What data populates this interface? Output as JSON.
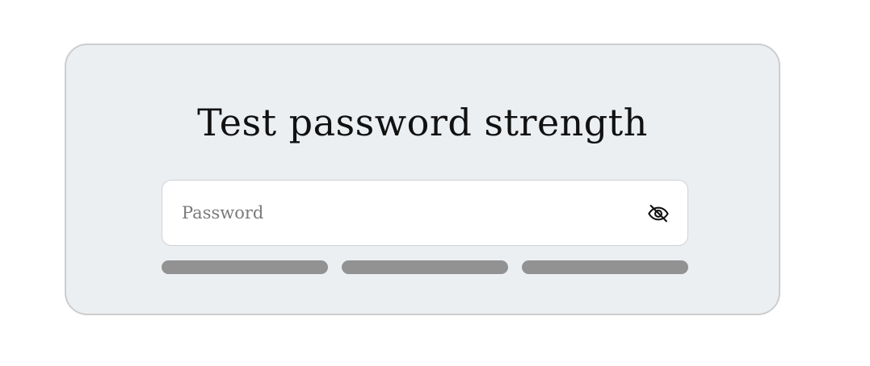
{
  "card": {
    "title": "Test password strength"
  },
  "password": {
    "placeholder": "Password",
    "value": "",
    "visibility_icon": "eye-slash-icon"
  },
  "strength_meter": {
    "segments": [
      {
        "filled": false
      },
      {
        "filled": false
      },
      {
        "filled": false
      }
    ],
    "inactive_color": "#929292"
  }
}
